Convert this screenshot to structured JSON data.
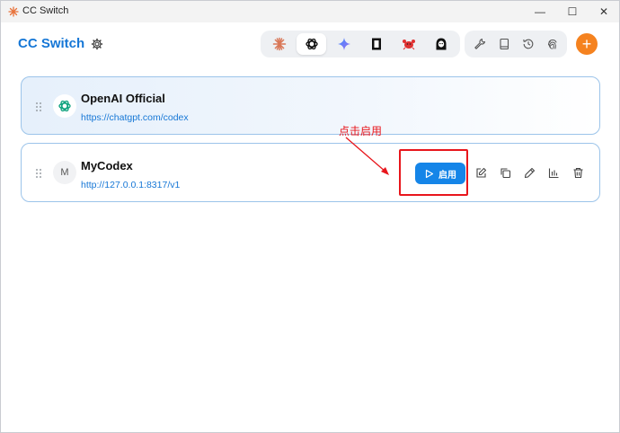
{
  "window": {
    "title": "CC Switch",
    "controls": {
      "minimize": "—",
      "maximize": "☐",
      "close": "✕"
    }
  },
  "header": {
    "brand": "CC Switch",
    "apps": [
      {
        "name": "claude-icon",
        "active": false
      },
      {
        "name": "openai-codex-icon",
        "active": true
      },
      {
        "name": "gemini-icon",
        "active": false
      },
      {
        "name": "opencode-icon",
        "active": false
      },
      {
        "name": "red-crab-icon",
        "active": false
      },
      {
        "name": "hooded-figure-icon",
        "active": false
      }
    ],
    "tools": [
      "wrench-icon",
      "book-icon",
      "history-icon",
      "fingerprint-icon"
    ],
    "add_label": "+"
  },
  "providers": [
    {
      "name": "OpenAI Official",
      "url": "https://chatgpt.com/codex",
      "icon": "openai-icon",
      "active": true
    },
    {
      "name": "MyCodex",
      "url": "http://127.0.0.1:8317/v1",
      "avatar_letter": "M",
      "active": false,
      "enable_label": "启用"
    }
  ],
  "annotation": {
    "text": "点击启用"
  },
  "colors": {
    "brand": "#1677d6",
    "accent_orange": "#f5821f",
    "enable_button": "#1585e8",
    "annotation_red": "#e8161c",
    "card_border": "#9cc4ea"
  }
}
